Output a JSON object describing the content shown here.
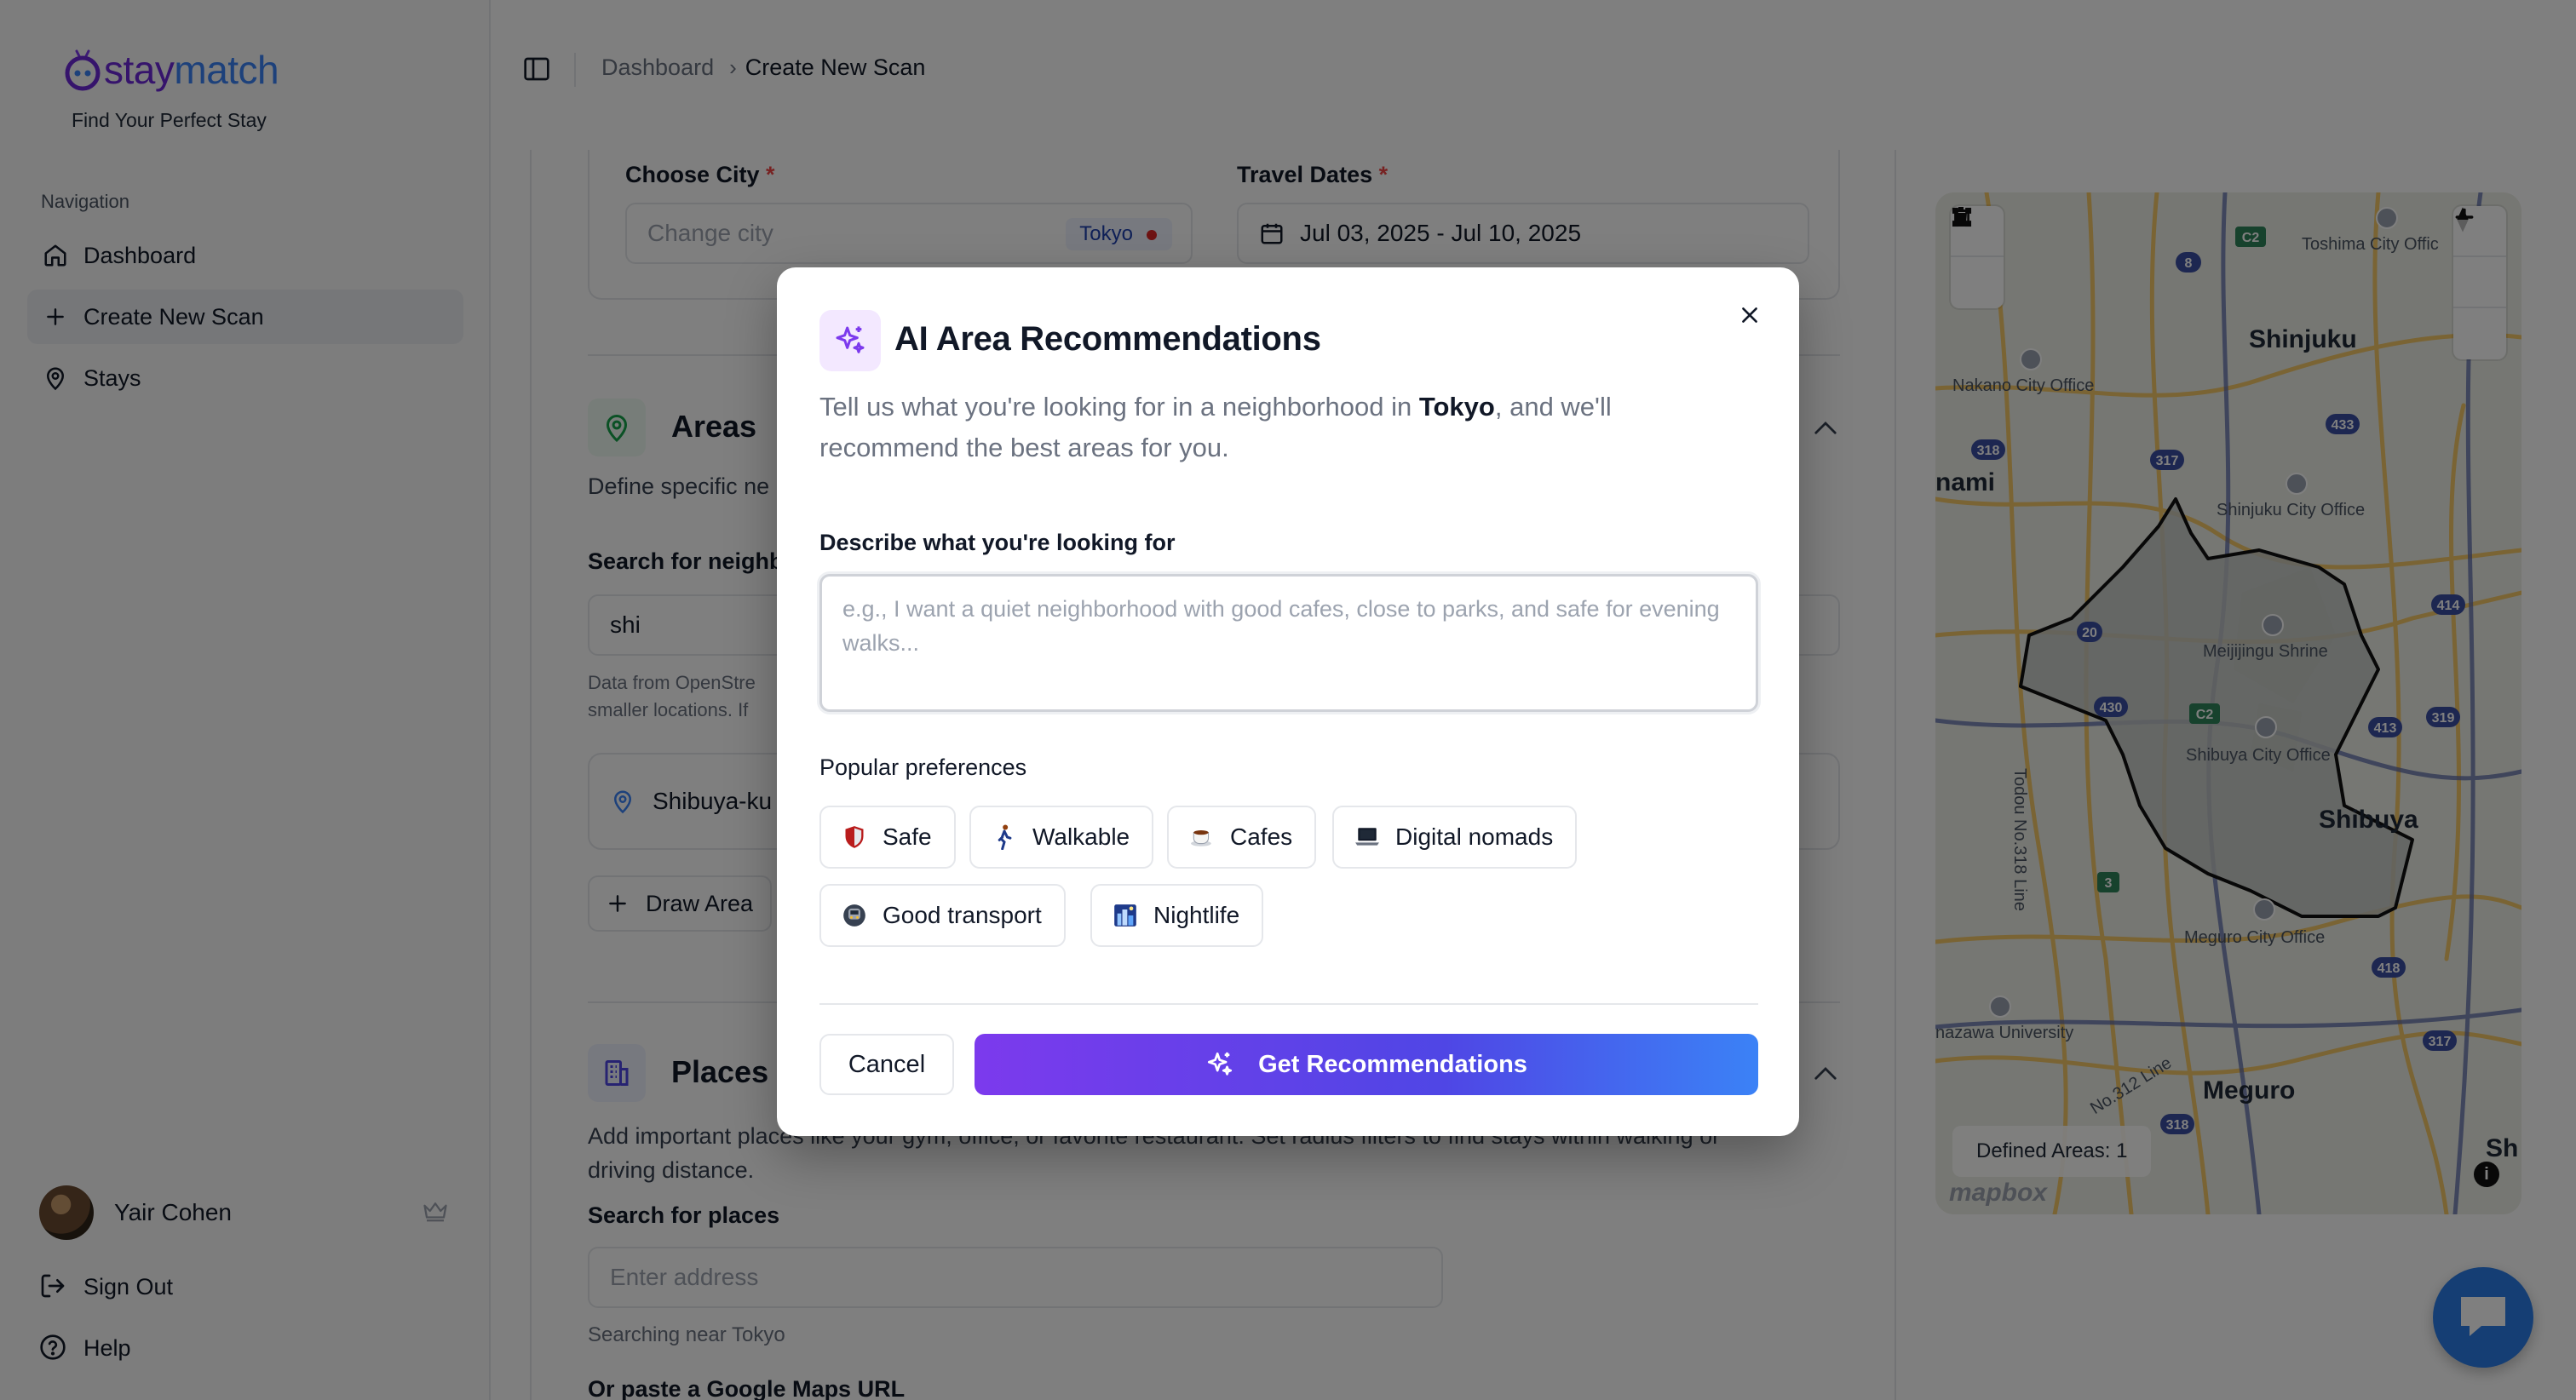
{
  "brand": {
    "name_part1": "stay",
    "name_part2": "match",
    "tagline": "Find Your Perfect Stay"
  },
  "sidebar": {
    "heading": "Navigation",
    "items": [
      {
        "label": "Dashboard",
        "icon": "home-icon",
        "active": false
      },
      {
        "label": "Create New Scan",
        "icon": "plus-icon",
        "active": true
      },
      {
        "label": "Stays",
        "icon": "map-pin-icon",
        "active": false
      }
    ],
    "user": {
      "name": "Yair Cohen",
      "badge_icon": "crown-icon"
    },
    "sign_out": "Sign Out",
    "help": "Help"
  },
  "header": {
    "breadcrumb": [
      "Dashboard",
      "Create New Scan"
    ]
  },
  "form": {
    "city_label": "Choose City",
    "city_placeholder": "Change city",
    "city_value": "Tokyo",
    "dates_label": "Travel Dates",
    "dates_value": "Jul 03, 2025 - Jul 10, 2025",
    "areas": {
      "title": "Areas",
      "description": "Define specific ne",
      "search_label": "Search for neighb",
      "search_value": "shi",
      "note_line1": "Data from OpenStre",
      "note_line2": "smaller locations. If",
      "result": "Shibuya-ku",
      "draw_area": "Draw Area"
    },
    "places": {
      "title": "Places I",
      "description_line1": "Add important places like your gym, office, or favorite restaurant. Set radius filters to find stays within walking or",
      "description_line2": "driving distance.",
      "search_label": "Search for places",
      "search_placeholder": "Enter address",
      "search_note": "Searching near Tokyo",
      "paste_label": "Or paste a Google Maps URL"
    }
  },
  "map": {
    "labels": [
      "Shinjuku",
      "Shibuya",
      "Meguro",
      "nami",
      "Sh"
    ],
    "small_labels": [
      "Toshima City Offic",
      "Nakano City Office",
      "Shinjuku City Office",
      "Meijijingu Shrine",
      "Shibuya City Office",
      "Meguro City Office",
      "nazawa University",
      "Todou No.318 Line",
      "No.312 Line"
    ],
    "route_badges": [
      "8",
      "C2",
      "433",
      "318",
      "317",
      "20",
      "414",
      "C2",
      "413",
      "319",
      "430",
      "3",
      "418",
      "317",
      "318"
    ],
    "defined_areas": "Defined Areas: 1",
    "attribution": "mapbox",
    "colors": {
      "land": "#eceee6",
      "area_fill": "#c9ccc9",
      "area_stroke": "#111111",
      "road": "#f4c869",
      "highway": "#4c5ea8"
    }
  },
  "modal": {
    "title": "AI Area Recommendations",
    "desc_prefix": "Tell us what you're looking for in a neighborhood in ",
    "desc_city": "Tokyo",
    "desc_suffix": ", and we'll recommend the best areas for you.",
    "textarea_label": "Describe what you're looking for",
    "textarea_placeholder": "e.g., I want a quiet neighborhood with good cafes, close to parks, and safe for evening walks...",
    "preferences_label": "Popular preferences",
    "preferences": [
      {
        "label": "Safe",
        "icon": "shield-icon"
      },
      {
        "label": "Walkable",
        "icon": "walking-person-icon"
      },
      {
        "label": "Cafes",
        "icon": "coffee-icon"
      },
      {
        "label": "Digital nomads",
        "icon": "laptop-icon"
      },
      {
        "label": "Good transport",
        "icon": "metro-icon"
      },
      {
        "label": "Nightlife",
        "icon": "night-city-icon"
      }
    ],
    "cancel": "Cancel",
    "submit": "Get Recommendations",
    "colors": {
      "gradient_start": "#7c3aed",
      "gradient_end": "#3b82f6",
      "icon_bg": "#f3e8ff"
    }
  }
}
